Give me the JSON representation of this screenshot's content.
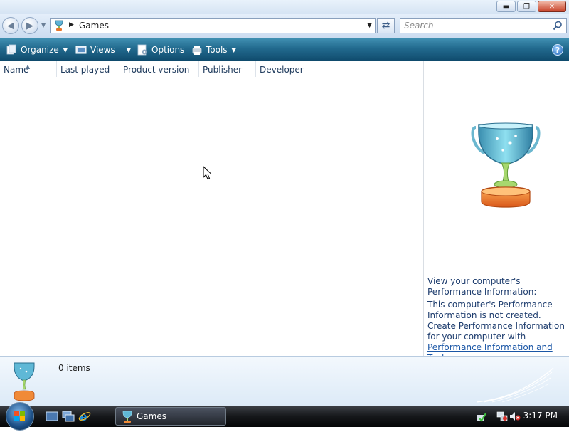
{
  "window": {
    "caption_buttons": {
      "minimize": "▬",
      "maximize": "❐",
      "close": "✕"
    }
  },
  "address_bar": {
    "location": "Games",
    "back_glyph": "◀",
    "forward_glyph": "▶",
    "refresh_glyph": "⇄"
  },
  "search": {
    "placeholder": "Search"
  },
  "command_bar": {
    "organize": "Organize",
    "views": "Views",
    "options": "Options",
    "tools": "Tools",
    "help": "?"
  },
  "columns": [
    "Name",
    "Last played",
    "Product version",
    "Publisher",
    "Developer"
  ],
  "preview_pane": {
    "title": "View your computer's Performance Information:",
    "not_created": "This computer's Performance Information is not created.",
    "create_prefix": "Create Performance Information for your computer with ",
    "link": "Performance Information and Tools",
    "suffix": "."
  },
  "details_pane": {
    "item_count": "0 items"
  },
  "taskbar": {
    "active_window": "Games",
    "clock": "3:17 PM"
  },
  "colors": {
    "command_bar": "#21698d",
    "accent_text": "#1e3d6e",
    "link": "#1a56a6"
  },
  "icons": [
    "trophy-icon",
    "organize-icon",
    "views-icon",
    "options-icon",
    "tools-icon",
    "help-icon",
    "search-icon",
    "refresh-icon",
    "back-icon",
    "forward-icon",
    "start-orb-icon",
    "show-desktop-icon",
    "switch-windows-icon",
    "ie-icon",
    "network-icon",
    "volume-muted-icon",
    "security-icon"
  ]
}
